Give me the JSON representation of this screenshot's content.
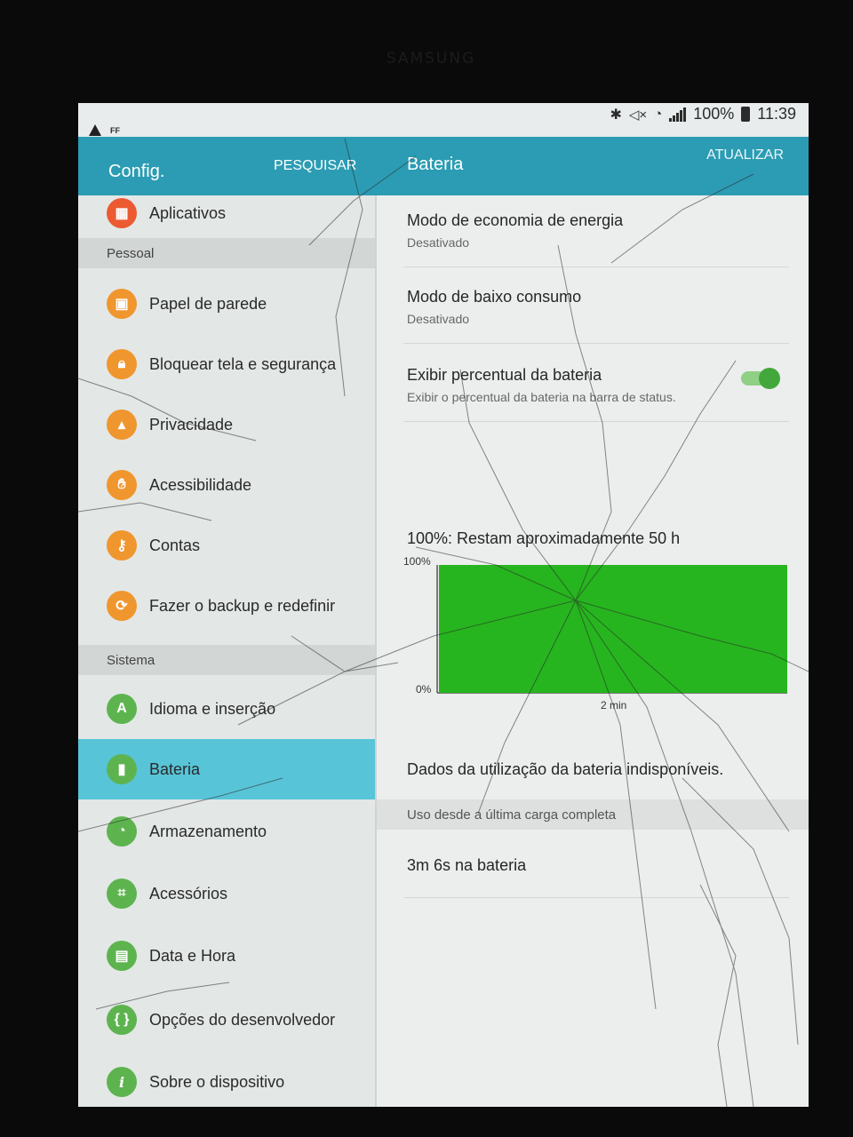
{
  "status_bar": {
    "battery_percent": "100%",
    "time": "11:39",
    "icons": [
      "warning-icon",
      "notification-icon",
      "bluetooth-icon",
      "mute-icon",
      "wifi-icon",
      "signal-icon",
      "battery-icon"
    ]
  },
  "left_header": {
    "title": "Config.",
    "search_label": "PESQUISAR"
  },
  "right_header": {
    "title": "Bateria",
    "refresh_label": "ATUALIZAR"
  },
  "menu": {
    "top_item": {
      "label": "Aplicativos",
      "icon": "apps-icon"
    },
    "section_personal": "Pessoal",
    "personal": [
      {
        "label": "Papel de parede",
        "icon": "wallpaper-icon"
      },
      {
        "label": "Bloquear tela e segurança",
        "icon": "lock-icon"
      },
      {
        "label": "Privacidade",
        "icon": "privacy-icon"
      },
      {
        "label": "Acessibilidade",
        "icon": "hand-icon"
      },
      {
        "label": "Contas",
        "icon": "key-icon"
      },
      {
        "label": "Fazer o backup e redefinir",
        "icon": "backup-icon"
      }
    ],
    "section_system": "Sistema",
    "system": [
      {
        "label": "Idioma e inserção",
        "icon": "language-icon"
      },
      {
        "label": "Bateria",
        "icon": "battery-icon",
        "active": true
      },
      {
        "label": "Armazenamento",
        "icon": "storage-icon"
      },
      {
        "label": "Acessórios",
        "icon": "accessories-icon"
      },
      {
        "label": "Data e Hora",
        "icon": "calendar-icon"
      },
      {
        "label": "Opções do desenvolvedor",
        "icon": "developer-icon"
      },
      {
        "label": "Sobre o dispositivo",
        "icon": "info-icon"
      }
    ]
  },
  "battery": {
    "power_saving": {
      "title": "Modo de economia de energia",
      "status": "Desativado"
    },
    "ultra_saving": {
      "title": "Modo de baixo consumo",
      "status": "Desativado"
    },
    "show_percent": {
      "title": "Exibir percentual da bateria",
      "subtitle": "Exibir o percentual da bateria na barra de status.",
      "enabled": true
    },
    "estimate": "100%: Restam aproximadamente 50 h",
    "usage_unavailable": "Dados da utilização da bateria indisponíveis.",
    "usage_since_header": "Uso desde a última carga completa",
    "time_on_battery": "3m 6s na bateria"
  },
  "chart_data": {
    "type": "area",
    "x": [
      0,
      2
    ],
    "y": [
      100,
      100
    ],
    "ylim": [
      0,
      100
    ],
    "ytick_labels": [
      "100%",
      "0%"
    ],
    "xtick_labels": [
      "2 min"
    ],
    "fill_color": "#26b51e"
  },
  "colors": {
    "accent": "#2b9cb3",
    "active_item": "#58c4d8",
    "toggle_on": "#43a83c"
  }
}
